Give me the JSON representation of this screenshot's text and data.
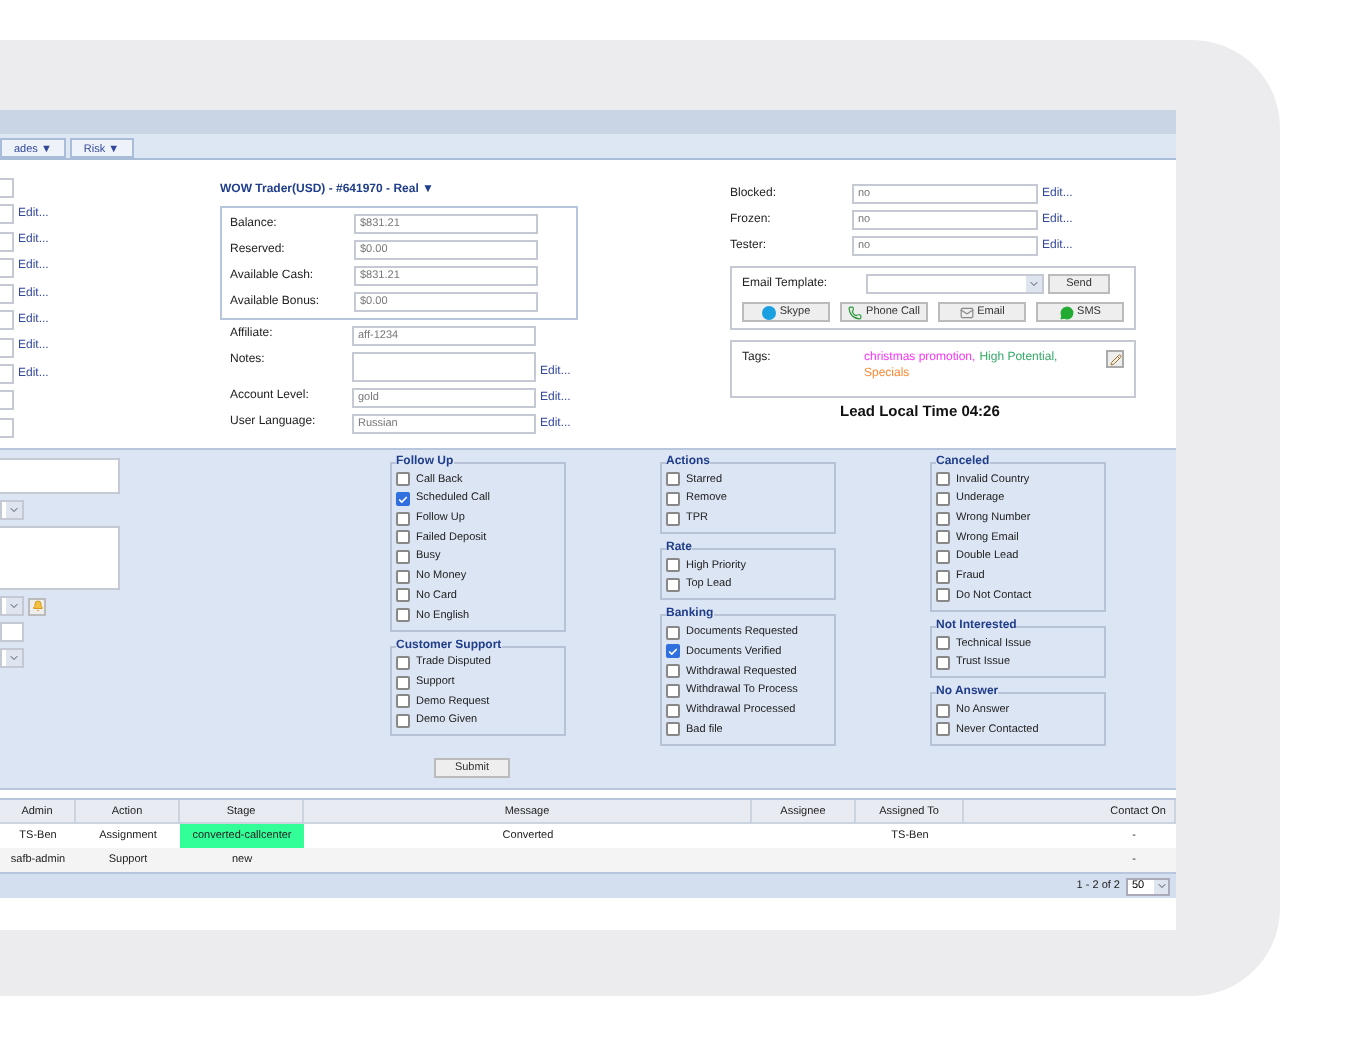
{
  "tabs": [
    {
      "label": "ades ▼",
      "selected": false
    },
    {
      "label": "Risk ▼",
      "selected": false
    }
  ],
  "left_fields": [
    {
      "kind": "input"
    },
    {
      "kind": "input",
      "edit": "Edit..."
    },
    {
      "kind": "input",
      "edit": "Edit..."
    },
    {
      "kind": "input",
      "edit": "Edit..."
    },
    {
      "kind": "input",
      "edit": "Edit..."
    },
    {
      "kind": "input",
      "edit": "Edit..."
    },
    {
      "kind": "input",
      "edit": "Edit..."
    },
    {
      "kind": "input",
      "edit": "Edit..."
    },
    {
      "kind": "input"
    },
    {
      "kind": "input"
    }
  ],
  "account": {
    "title": "WOW Trader(USD) - #641970 - Real ▼",
    "balances": [
      {
        "label": "Balance:",
        "value": "$831.21"
      },
      {
        "label": "Reserved:",
        "value": "$0.00"
      },
      {
        "label": "Available Cash:",
        "value": "$831.21"
      },
      {
        "label": "Available Bonus:",
        "value": "$0.00"
      }
    ],
    "fields": [
      {
        "kind": "input",
        "label": "Affiliate:",
        "value": "aff-1234"
      },
      {
        "kind": "textarea",
        "label": "Notes:",
        "edit": "Edit..."
      },
      {
        "kind": "input",
        "label": "Account Level:",
        "value": "gold",
        "edit": "Edit..."
      },
      {
        "kind": "input",
        "label": "User Language:",
        "value": "Russian",
        "edit": "Edit..."
      }
    ]
  },
  "status_fields": [
    {
      "label": "Blocked:",
      "value": "no",
      "edit": "Edit..."
    },
    {
      "label": "Frozen:",
      "value": "no",
      "edit": "Edit..."
    },
    {
      "label": "Tester:",
      "value": "no",
      "edit": "Edit..."
    }
  ],
  "email": {
    "label": "Email Template:",
    "send": "Send",
    "buttons": [
      {
        "kind": "skype",
        "label": "Skype"
      },
      {
        "kind": "phone",
        "label": "Phone Call"
      },
      {
        "kind": "email",
        "label": "Email"
      },
      {
        "kind": "sms",
        "label": "SMS"
      }
    ]
  },
  "tags": {
    "label": "Tags:",
    "items": [
      {
        "text": "christmas promotion,",
        "color": "#ff33ff"
      },
      {
        "text": "High Potential,",
        "color": "#33aa66"
      },
      {
        "text": "Specials",
        "color": "#ff8833"
      }
    ]
  },
  "lead_time": "Lead Local Time 04:26",
  "lower_left": [
    {
      "kind": "textbox"
    },
    {
      "kind": "select"
    },
    {
      "kind": "textarea"
    },
    {
      "kind": "select_alert"
    },
    {
      "kind": "input"
    },
    {
      "kind": "select"
    }
  ],
  "columns": [
    [
      {
        "title": "Follow Up",
        "items": [
          {
            "label": "Call Back",
            "checked": false
          },
          {
            "label": "Scheduled Call",
            "checked": true
          },
          {
            "label": "Follow Up",
            "checked": false
          },
          {
            "label": "Failed Deposit",
            "checked": false
          },
          {
            "label": "Busy",
            "checked": false
          },
          {
            "label": "No Money",
            "checked": false
          },
          {
            "label": "No Card",
            "checked": false
          },
          {
            "label": "No English",
            "checked": false
          }
        ]
      },
      {
        "title": "Customer Support",
        "items": [
          {
            "label": "Trade Disputed",
            "checked": false
          },
          {
            "label": "Support",
            "checked": false
          },
          {
            "label": "Demo Request",
            "checked": false
          },
          {
            "label": "Demo Given",
            "checked": false
          }
        ]
      }
    ],
    [
      {
        "title": "Actions",
        "items": [
          {
            "label": "Starred",
            "checked": false
          },
          {
            "label": "Remove",
            "checked": false
          },
          {
            "label": "TPR",
            "checked": false
          }
        ]
      },
      {
        "title": "Rate",
        "items": [
          {
            "label": "High Priority",
            "checked": false
          },
          {
            "label": "Top Lead",
            "checked": false
          }
        ]
      },
      {
        "title": "Banking",
        "items": [
          {
            "label": "Documents Requested",
            "checked": false
          },
          {
            "label": "Documents Verified",
            "checked": true
          },
          {
            "label": "Withdrawal Requested",
            "checked": false
          },
          {
            "label": "Withdrawal To Process",
            "checked": false
          },
          {
            "label": "Withdrawal Processed",
            "checked": false
          },
          {
            "label": "Bad file",
            "checked": false
          }
        ]
      }
    ],
    [
      {
        "title": "Canceled",
        "items": [
          {
            "label": "Invalid Country",
            "checked": false
          },
          {
            "label": "Underage",
            "checked": false
          },
          {
            "label": "Wrong Number",
            "checked": false
          },
          {
            "label": "Wrong Email",
            "checked": false
          },
          {
            "label": "Double Lead",
            "checked": false
          },
          {
            "label": "Fraud",
            "checked": false
          },
          {
            "label": "Do Not Contact",
            "checked": false
          }
        ]
      },
      {
        "title": "Not Interested",
        "items": [
          {
            "label": "Technical Issue",
            "checked": false
          },
          {
            "label": "Trust Issue",
            "checked": false
          }
        ]
      },
      {
        "title": "No Answer",
        "items": [
          {
            "label": "No Answer",
            "checked": false
          },
          {
            "label": "Never Contacted",
            "checked": false
          }
        ]
      }
    ]
  ],
  "submit": "Submit",
  "table": {
    "columns": [
      "Admin",
      "Action",
      "Stage",
      "Message",
      "Assignee",
      "Assigned To",
      "Contact On"
    ],
    "rows": [
      {
        "admin": "TS-Ben",
        "action": "Assignment",
        "stage": "converted-callcenter",
        "color": "#33ff99",
        "message": "Converted",
        "assigned_to": "TS-Ben",
        "contact_on": "-"
      },
      {
        "admin": "safb-admin",
        "action": "Support",
        "stage": "new",
        "contact_on": "-"
      }
    ]
  },
  "pagination": {
    "range": "1 - 2 of 2",
    "page_size": "50"
  }
}
